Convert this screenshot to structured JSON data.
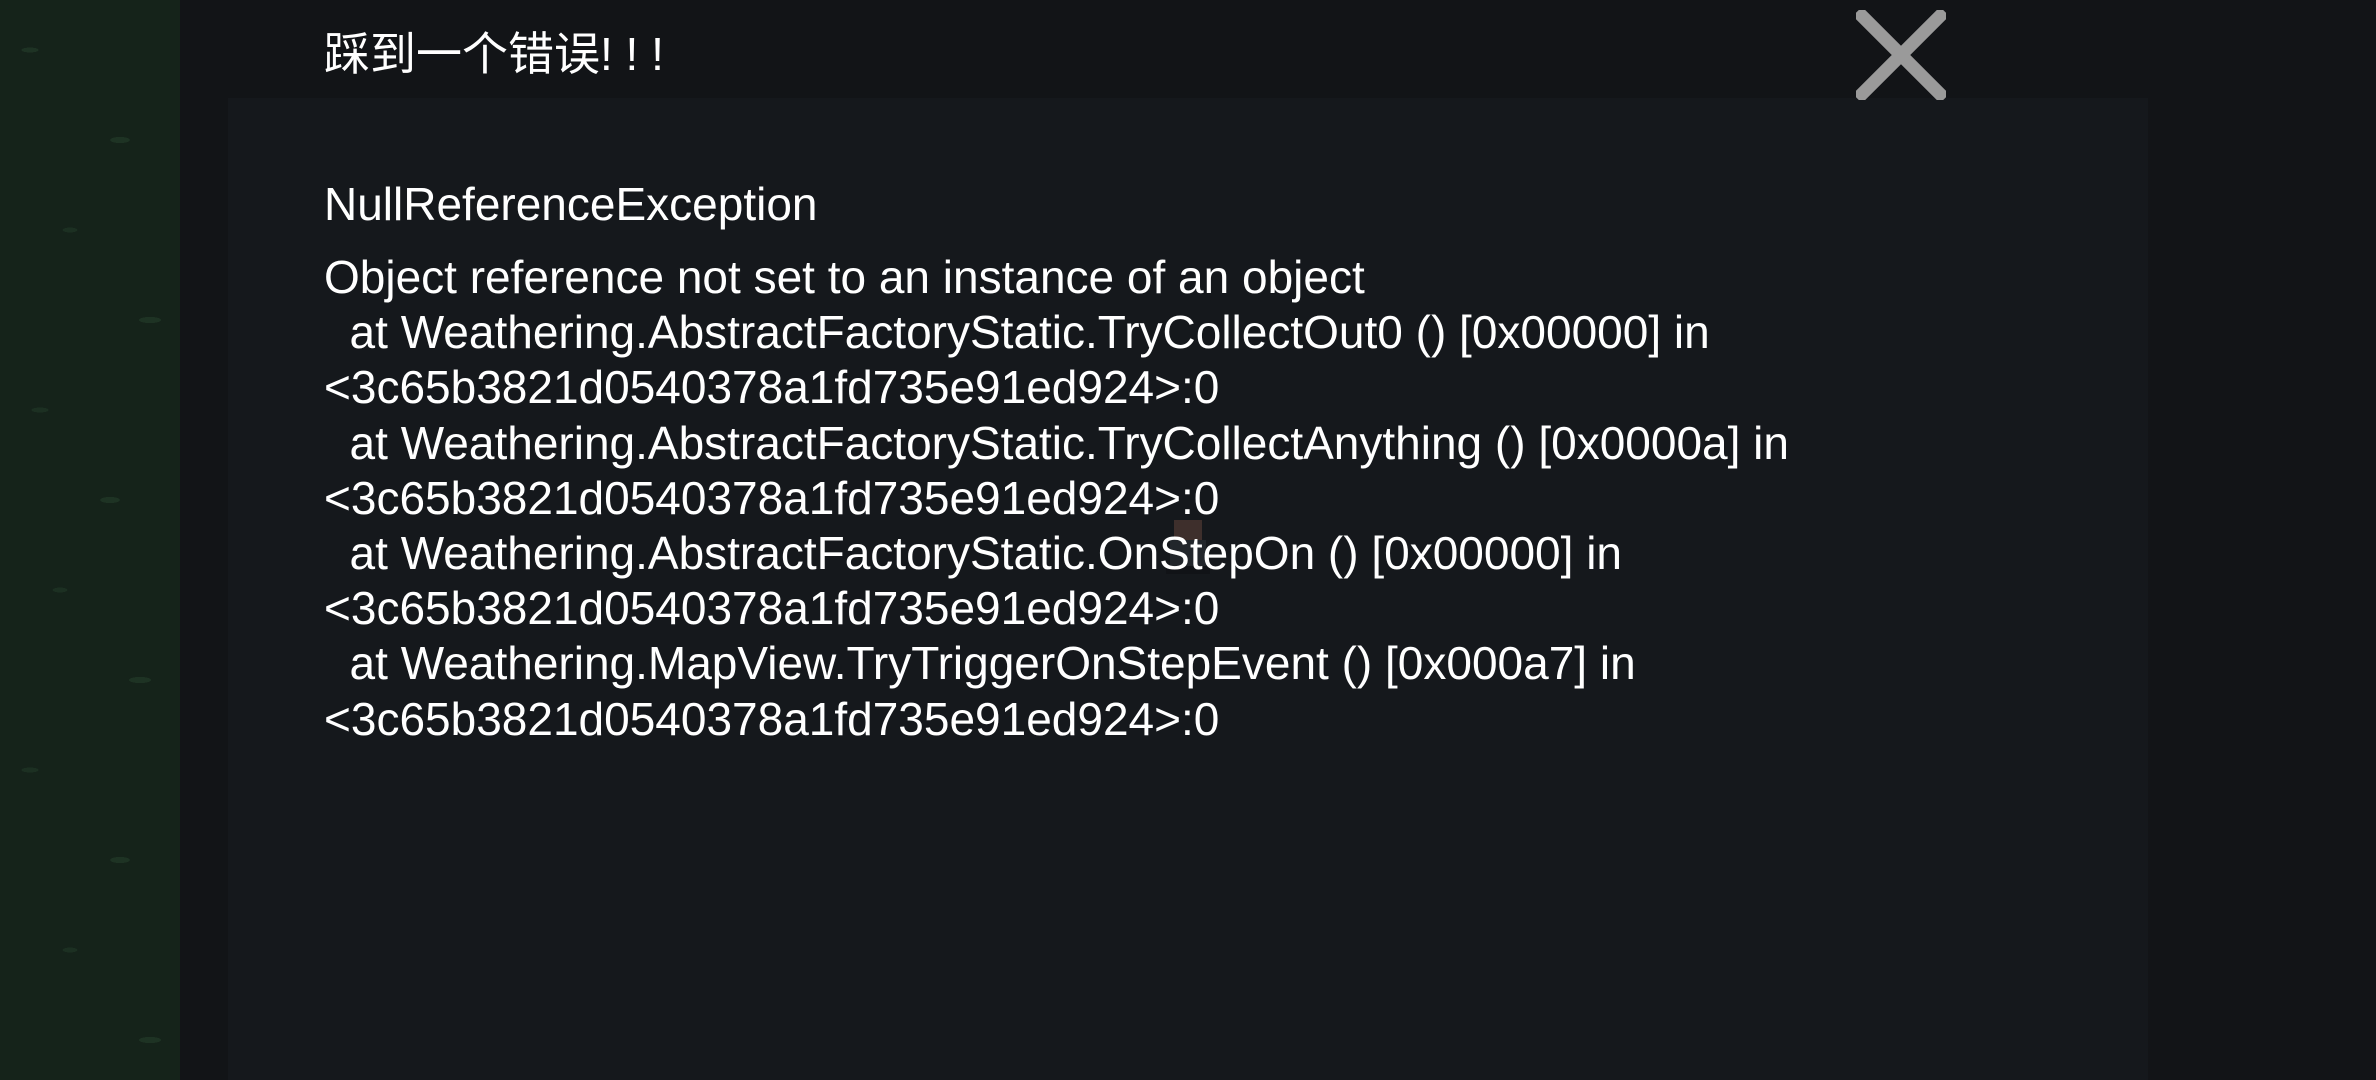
{
  "dialog": {
    "title": "踩到一个错误! ! !",
    "close_icon": "close-x-icon",
    "exception_name": "NullReferenceException",
    "message_lines": [
      "Object reference not set to an instance of an object",
      "  at Weathering.AbstractFactoryStatic.TryCollectOut0 () [0x00000] in",
      "<3c65b3821d0540378a1fd735e91ed924>:0",
      "  at Weathering.AbstractFactoryStatic.TryCollectAnything () [0x0000a] in",
      "<3c65b3821d0540378a1fd735e91ed924>:0",
      "  at Weathering.AbstractFactoryStatic.OnStepOn () [0x00000] in",
      "<3c65b3821d0540378a1fd735e91ed924>:0",
      "  at Weathering.MapView.TryTriggerOnStepEvent () [0x000a7] in",
      "<3c65b3821d0540378a1fd735e91ed924>:0"
    ]
  },
  "colors": {
    "background": "#121417",
    "panel": "#15181c",
    "text": "#ffffff",
    "close_icon": "#9a9a9a",
    "game_grass": "#15231a"
  }
}
